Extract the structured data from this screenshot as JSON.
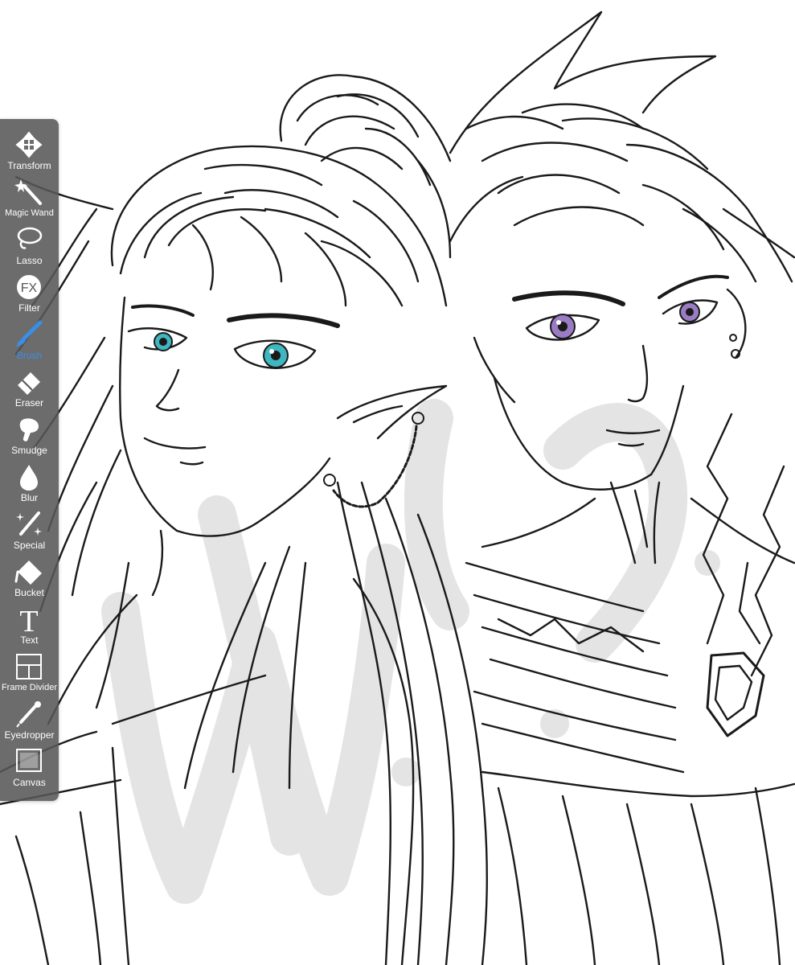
{
  "app": {
    "active_tool": "Brush",
    "accent_color": "#3a8ee6"
  },
  "toolbar": {
    "tools": [
      {
        "label": "Transform",
        "icon": "transform-icon"
      },
      {
        "label": "Magic Wand",
        "icon": "magic-wand-icon"
      },
      {
        "label": "Lasso",
        "icon": "lasso-icon"
      },
      {
        "label": "Filter",
        "icon": "fx-filter-icon"
      },
      {
        "label": "Brush",
        "icon": "brush-icon"
      },
      {
        "label": "Eraser",
        "icon": "eraser-icon"
      },
      {
        "label": "Smudge",
        "icon": "smudge-icon"
      },
      {
        "label": "Blur",
        "icon": "blur-drop-icon"
      },
      {
        "label": "Special",
        "icon": "special-icon"
      },
      {
        "label": "Bucket",
        "icon": "bucket-icon"
      },
      {
        "label": "Text",
        "icon": "text-icon"
      },
      {
        "label": "Frame Divider",
        "icon": "frame-divider-icon"
      },
      {
        "label": "Eyedropper",
        "icon": "eyedropper-icon"
      },
      {
        "label": "Canvas",
        "icon": "canvas-icon"
      }
    ]
  },
  "artwork": {
    "description_colors": {
      "left_eye": "#3fb6c0",
      "right_eye": "#9a7cc4",
      "watermark": "#e6e6e6",
      "lineart": "#1a1a1a"
    }
  }
}
